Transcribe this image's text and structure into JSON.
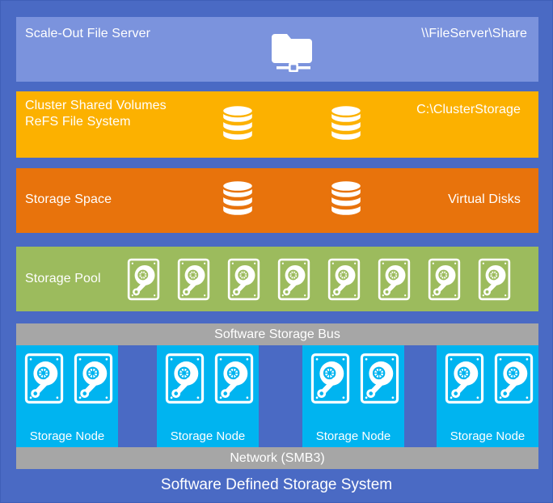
{
  "diagram": {
    "title": "Software Defined Storage System",
    "background_color": "#4a6ac4",
    "layers": {
      "file_server": {
        "name": "Scale-Out File Server",
        "path": "\\\\FileServer\\Share",
        "color": "#7b93dd",
        "icon": "shared-folder-icon"
      },
      "cluster_shared_volumes": {
        "name": "Cluster Shared Volumes\nReFS File System",
        "path": "C:\\ClusterStorage",
        "color": "#fcb100",
        "icon": "database-cylinder-icon",
        "icon_count": 2
      },
      "storage_space": {
        "name": "Storage Space",
        "right_label": "Virtual Disks",
        "color": "#e8730c",
        "icon": "database-cylinder-icon",
        "icon_count": 2
      },
      "storage_pool": {
        "name": "Storage Pool",
        "color": "#9cbb5d",
        "icon": "hard-disk-icon",
        "disk_count": 8
      },
      "software_storage_bus": {
        "name": "Software Storage Bus",
        "color": "#a6a6a6"
      },
      "nodes": {
        "color": "#00b4f0",
        "disks_per_node": 2,
        "icon": "hard-disk-icon",
        "items": [
          {
            "label": "Storage Node"
          },
          {
            "label": "Storage Node"
          },
          {
            "label": "Storage Node"
          },
          {
            "label": "Storage Node"
          }
        ]
      },
      "network": {
        "name": "Network (SMB3)",
        "color": "#a6a6a6"
      }
    }
  }
}
